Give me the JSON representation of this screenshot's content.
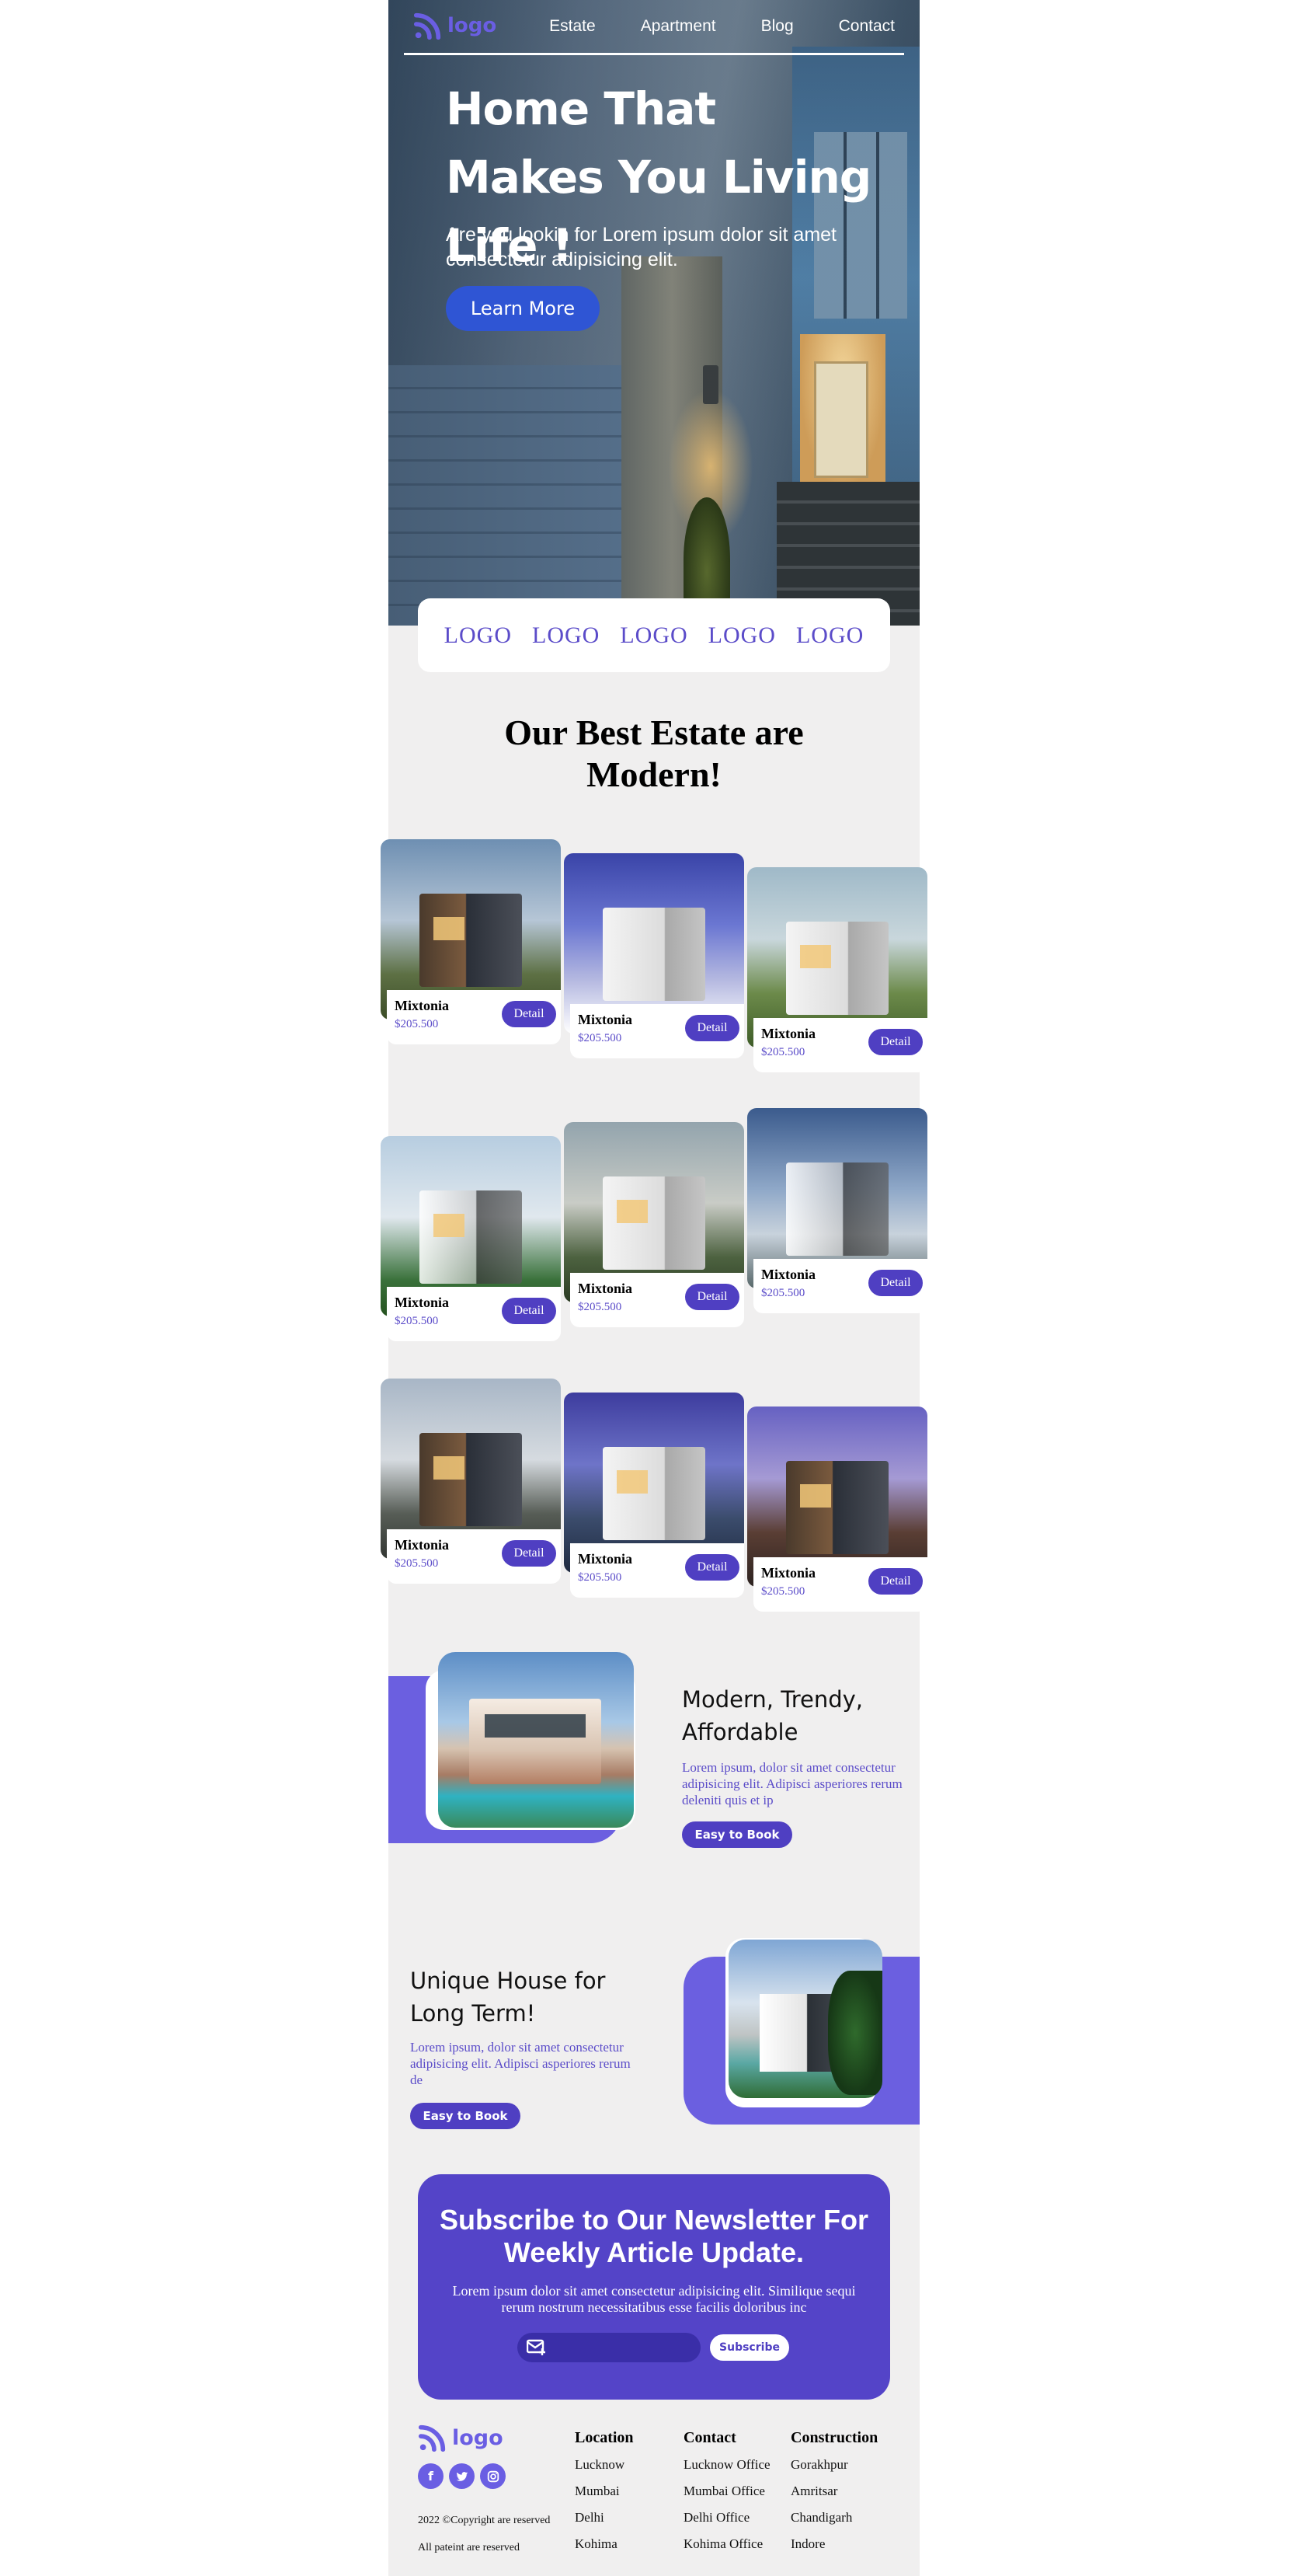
{
  "nav": {
    "logo": "logo",
    "links": [
      "Estate",
      "Apartment",
      "Blog",
      "Contact"
    ]
  },
  "hero": {
    "title": "Home That Makes You Living Life !",
    "subtitle": "Are you lookin for Lorem ipsum dolor sit amet consectetur adipisicing elit.",
    "button": "Learn More"
  },
  "partners": [
    "LOGO",
    "LOGO",
    "LOGO",
    "LOGO",
    "LOGO"
  ],
  "estates": {
    "title": "Our Best Estate are Modern!",
    "cards": [
      {
        "name": "Mixtonia",
        "price": "$205.500",
        "button": "Detail"
      },
      {
        "name": "Mixtonia",
        "price": "$205.500",
        "button": "Detail"
      },
      {
        "name": "Mixtonia",
        "price": "$205.500",
        "button": "Detail"
      },
      {
        "name": "Mixtonia",
        "price": "$205.500",
        "button": "Detail"
      },
      {
        "name": "Mixtonia",
        "price": "$205.500",
        "button": "Detail"
      },
      {
        "name": "Mixtonia",
        "price": "$205.500",
        "button": "Detail"
      },
      {
        "name": "Mixtonia",
        "price": "$205.500",
        "button": "Detail"
      },
      {
        "name": "Mixtonia",
        "price": "$205.500",
        "button": "Detail"
      },
      {
        "name": "Mixtonia",
        "price": "$205.500",
        "button": "Detail"
      }
    ]
  },
  "feature1": {
    "title": "Modern, Trendy, Affordable",
    "text": "Lorem ipsum, dolor sit amet consectetur adipisicing elit. Adipisci asperiores rerum deleniti quis et ip",
    "button": "Easy to Book"
  },
  "feature2": {
    "title": "Unique House for Long Term!",
    "text": "Lorem ipsum, dolor sit amet consectetur adipisicing elit. Adipisci asperiores rerum de",
    "button": "Easy to Book"
  },
  "newsletter": {
    "title": "Subscribe to Our Newsletter For Weekly Article Update.",
    "text": "Lorem ipsum dolor sit amet consectetur adipisicing elit. Similique sequi rerum nostrum necessitatibus esse facilis doloribus inc",
    "input_placeholder": "",
    "button": "Subscribe"
  },
  "footer": {
    "logo": "logo",
    "socials": [
      "f",
      "t",
      "o"
    ],
    "copyright": "2022 ©Copyright are reserved",
    "rights": "All pateint are reserved",
    "columns": [
      {
        "title": "Location",
        "items": [
          "Lucknow",
          "Mumbai",
          "Delhi",
          "Kohima"
        ]
      },
      {
        "title": "Contact",
        "items": [
          "Lucknow Office",
          "Mumbai Office",
          "Delhi Office",
          "Kohima Office"
        ]
      },
      {
        "title": "Construction",
        "items": [
          "Gorakhpur",
          "Amritsar",
          "Chandigarh",
          "Indore"
        ]
      }
    ]
  },
  "colors": {
    "accent": "#5444c8",
    "accent_light": "#6b5fe0",
    "hero_button": "#2f55d4",
    "background": "#f0efef"
  },
  "icons": [
    "logo-mark-icon",
    "mail-icon",
    "facebook-icon",
    "twitter-icon",
    "instagram-icon"
  ]
}
